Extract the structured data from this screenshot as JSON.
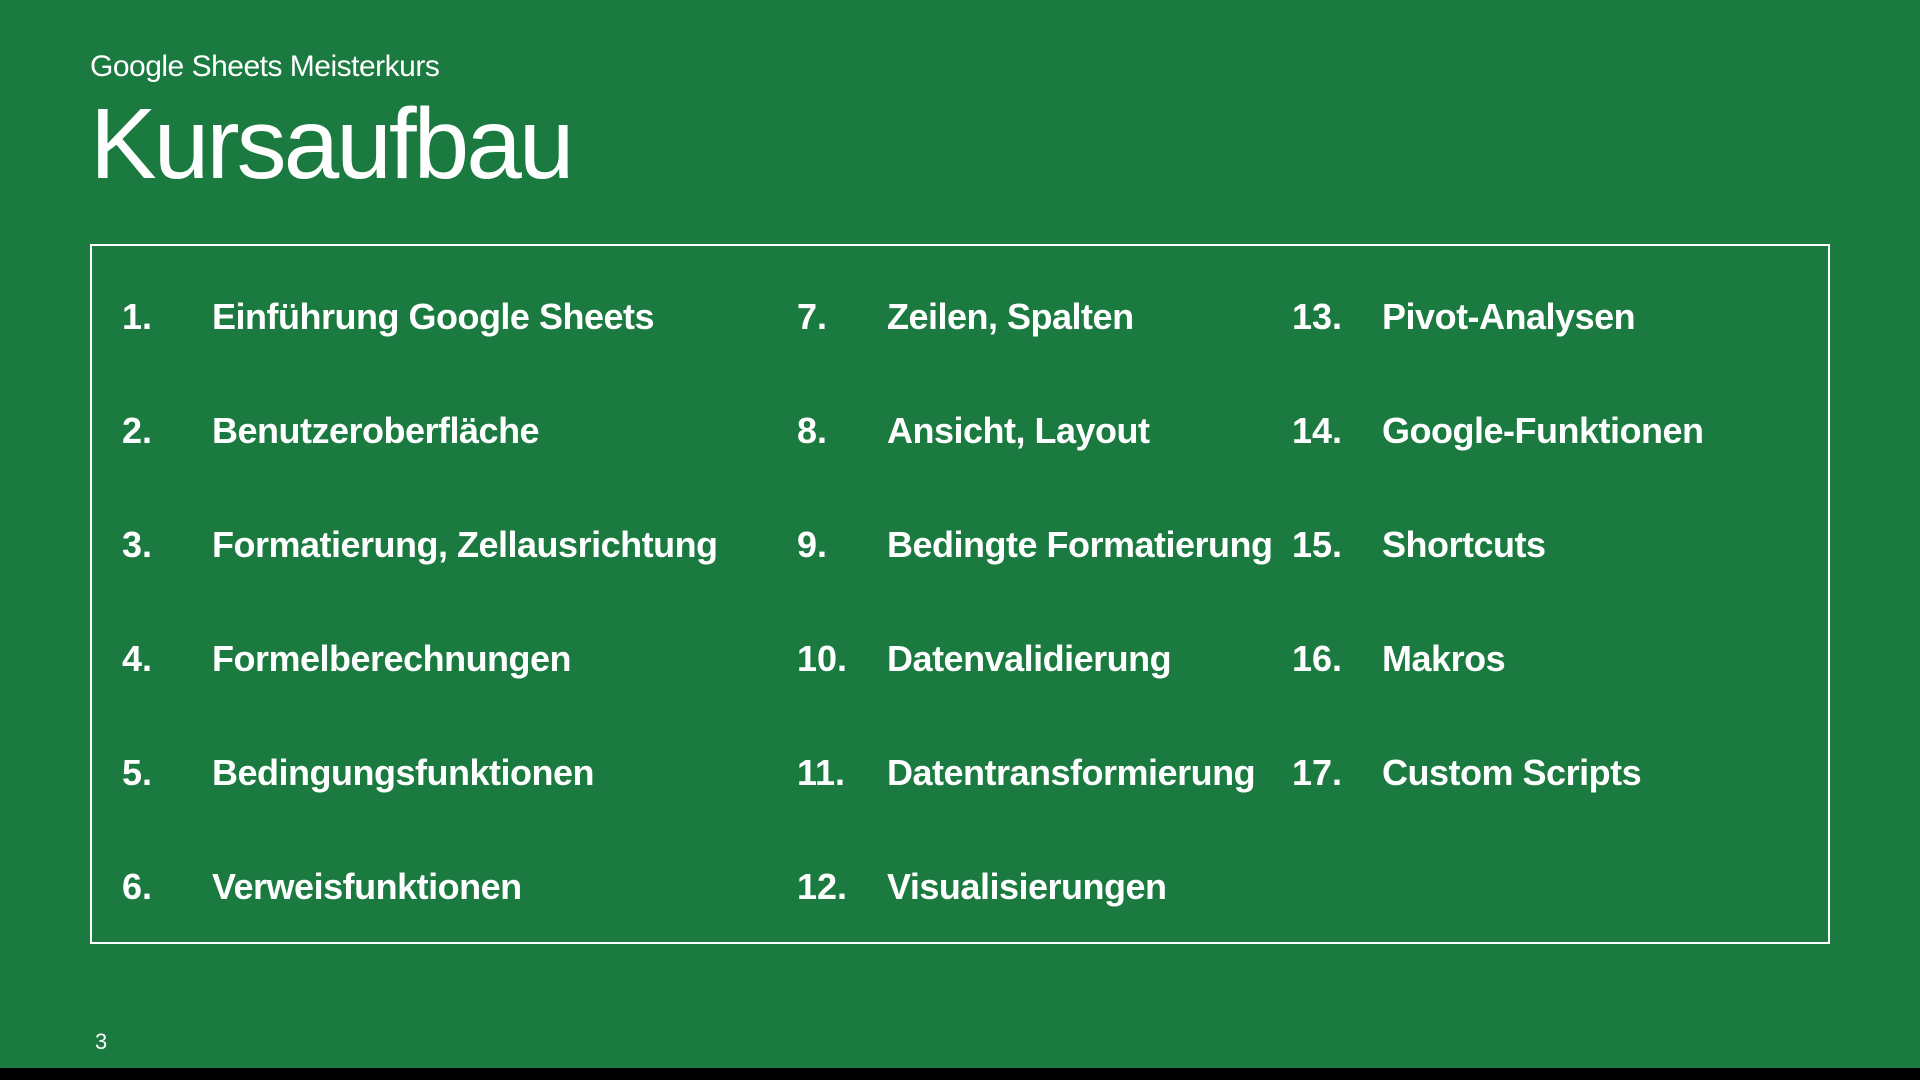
{
  "subtitle": "Google Sheets Meisterkurs",
  "title": "Kursaufbau",
  "pageNumber": "3",
  "columns": [
    {
      "items": [
        {
          "number": "1.",
          "label": "Einführung Google Sheets"
        },
        {
          "number": "2.",
          "label": "Benutzeroberfläche"
        },
        {
          "number": "3.",
          "label": "Formatierung, Zellausrichtung"
        },
        {
          "number": "4.",
          "label": "Formelberechnungen"
        },
        {
          "number": "5.",
          "label": "Bedingungsfunktionen"
        },
        {
          "number": "6.",
          "label": "Verweisfunktionen"
        }
      ]
    },
    {
      "items": [
        {
          "number": "7.",
          "label": "Zeilen, Spalten"
        },
        {
          "number": "8.",
          "label": "Ansicht, Layout"
        },
        {
          "number": "9.",
          "label": "Bedingte Formatierung"
        },
        {
          "number": "10.",
          "label": "Datenvalidierung"
        },
        {
          "number": "11.",
          "label": "Datentransformierung"
        },
        {
          "number": "12.",
          "label": "Visualisierungen"
        }
      ]
    },
    {
      "items": [
        {
          "number": "13.",
          "label": "Pivot-Analysen"
        },
        {
          "number": "14.",
          "label": "Google-Funktionen"
        },
        {
          "number": "15.",
          "label": "Shortcuts"
        },
        {
          "number": "16.",
          "label": "Makros"
        },
        {
          "number": "17.",
          "label": "Custom Scripts"
        }
      ]
    }
  ]
}
